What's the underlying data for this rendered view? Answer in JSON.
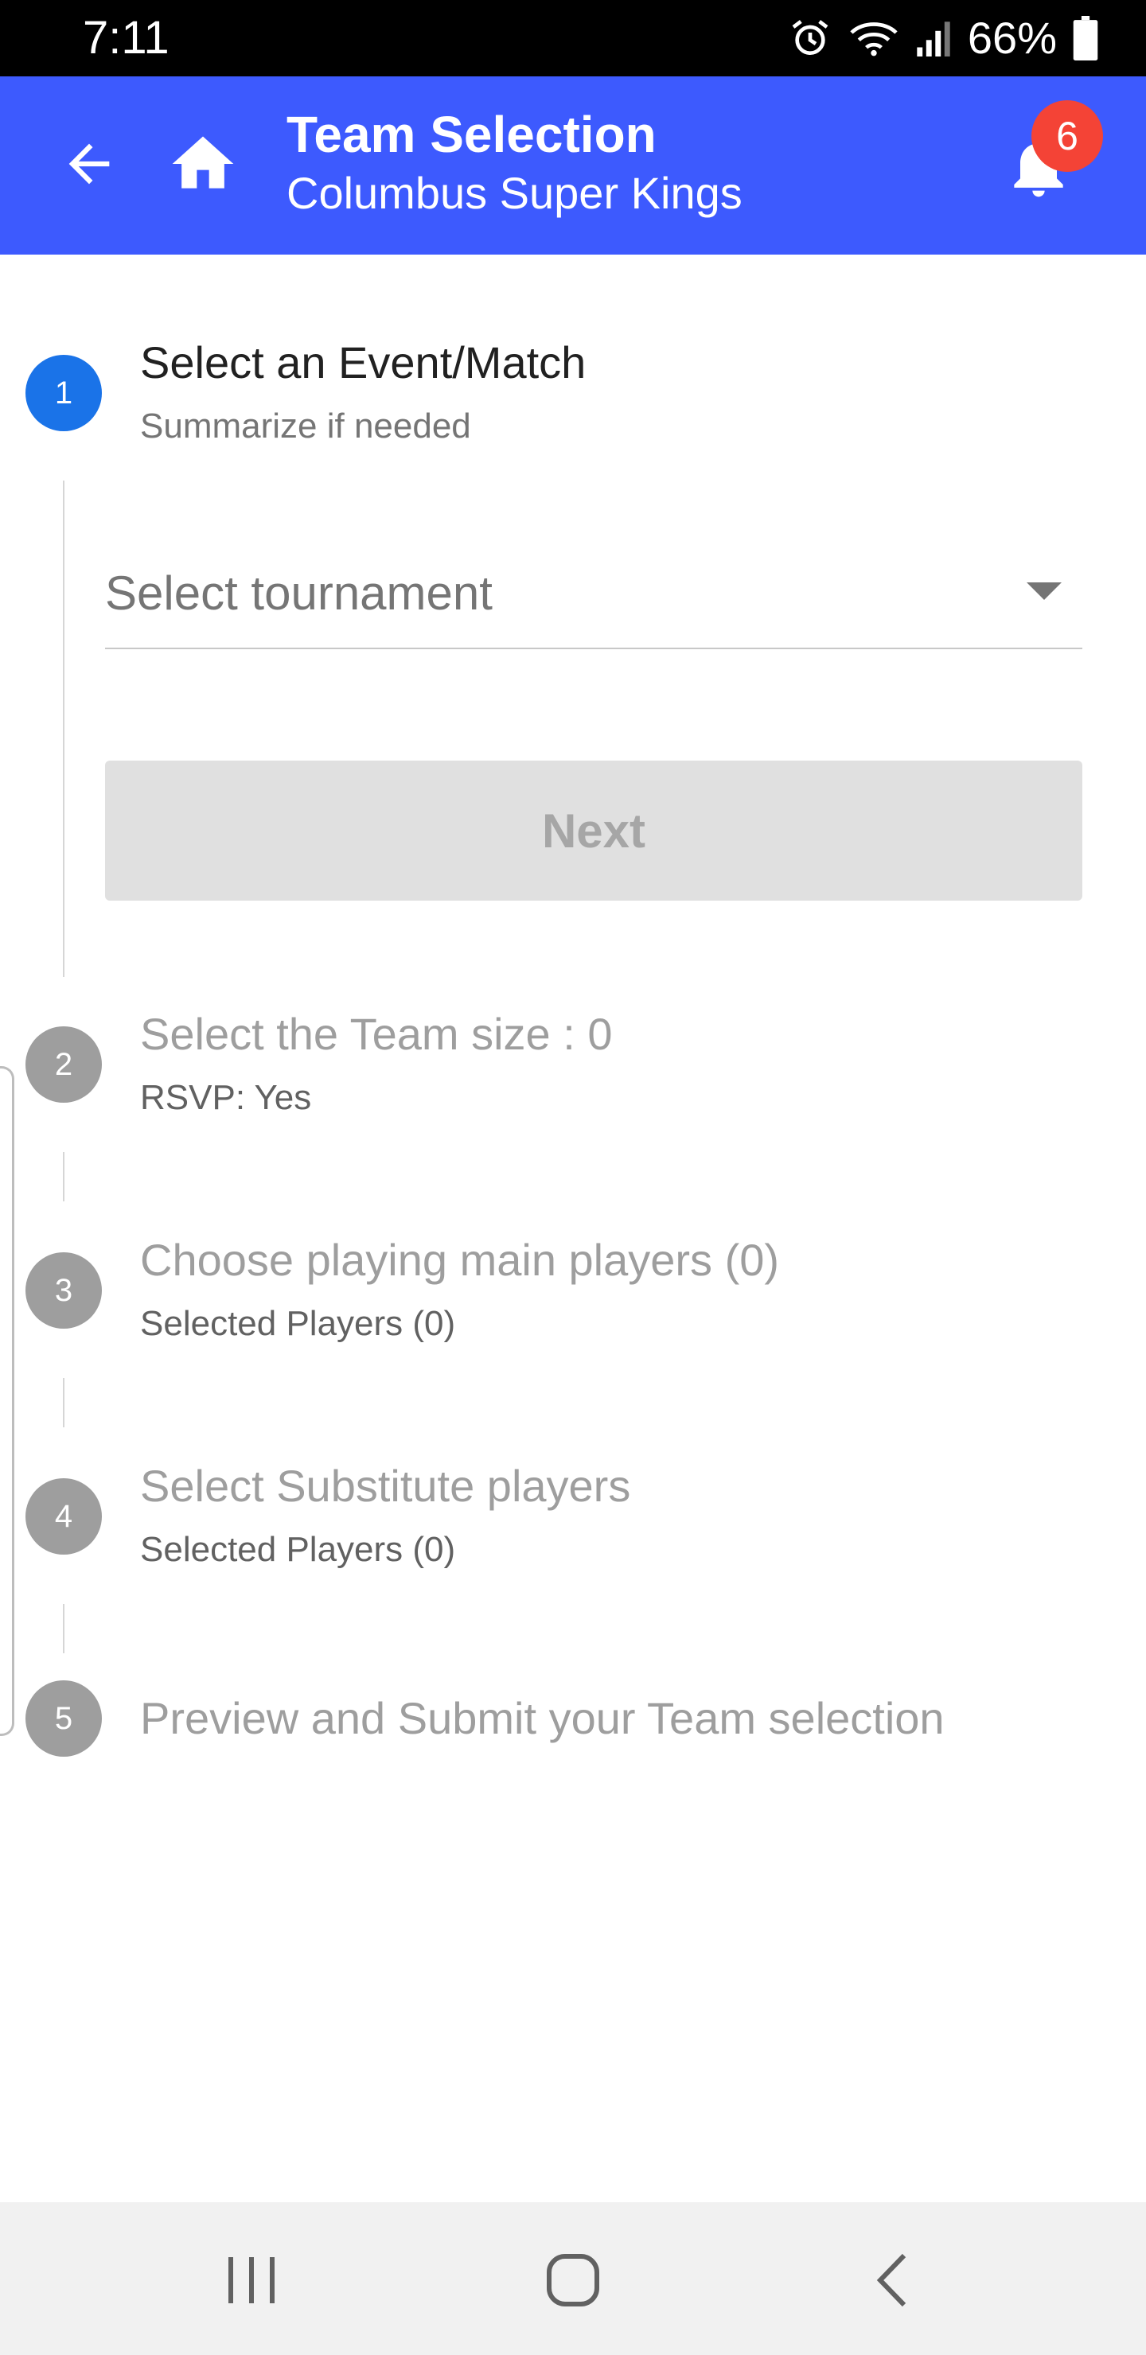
{
  "status_bar": {
    "time": "7:11",
    "battery_percent": "66%",
    "icons": [
      "alarm-icon",
      "wifi-icon",
      "signal-icon",
      "battery-icon"
    ]
  },
  "app_bar": {
    "title": "Team Selection",
    "subtitle": "Columbus Super Kings",
    "notification_count": "6",
    "color": "#3d5afe",
    "icons": [
      "back-arrow-icon",
      "home-icon",
      "bell-icon"
    ]
  },
  "stepper": {
    "steps": [
      {
        "number": "1",
        "title": "Select an Event/Match",
        "subtitle": "Summarize if needed",
        "state": "active"
      },
      {
        "number": "2",
        "title": "Select the Team size : 0",
        "subtitle": "RSVP: Yes",
        "state": "inactive"
      },
      {
        "number": "3",
        "title": "Choose playing main players (0)",
        "subtitle": "Selected Players (0)",
        "state": "inactive"
      },
      {
        "number": "4",
        "title": "Select Substitute players",
        "subtitle": "Selected Players (0)",
        "state": "inactive"
      },
      {
        "number": "5",
        "title": "Preview and Submit your Team selection",
        "subtitle": "",
        "state": "inactive"
      }
    ],
    "active_color": "#1a73e8",
    "inactive_color": "#9e9e9e"
  },
  "step1": {
    "tournament_select": {
      "placeholder": "Select tournament",
      "selected": ""
    },
    "next_label": "Next",
    "next_enabled": false
  },
  "nav_bar": {
    "buttons": [
      "recent-apps-icon",
      "home-circle-icon",
      "back-chevron-icon"
    ]
  }
}
